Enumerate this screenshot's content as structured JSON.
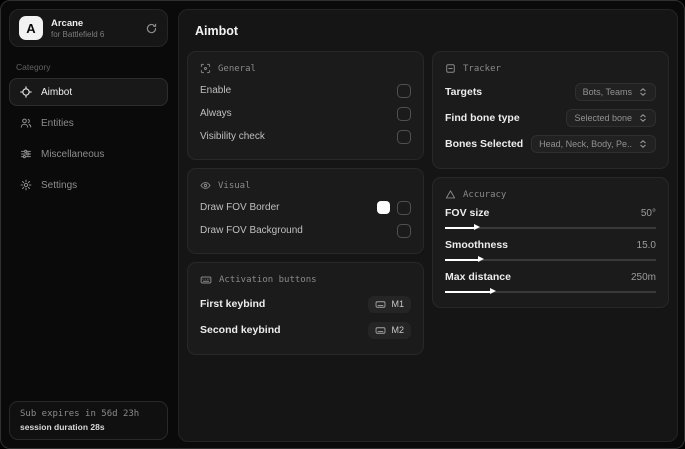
{
  "sidebar": {
    "logo_letter": "A",
    "app_name": "Arcane",
    "app_subtitle": "for Battlefield 6",
    "category_label": "Category",
    "items": [
      {
        "label": "Aimbot",
        "icon": "crosshair-icon",
        "active": true
      },
      {
        "label": "Entities",
        "icon": "users-icon",
        "active": false
      },
      {
        "label": "Miscellaneous",
        "icon": "sliders-icon",
        "active": false
      },
      {
        "label": "Settings",
        "icon": "gear-icon",
        "active": false
      }
    ],
    "footer": {
      "expiry": "Sub expires in 56d 23h",
      "session": "session duration 28s"
    }
  },
  "main": {
    "title": "Aimbot",
    "general": {
      "title": "General",
      "rows": [
        {
          "label": "Enable",
          "checked": false
        },
        {
          "label": "Always",
          "checked": false
        },
        {
          "label": "Visibility check",
          "checked": false
        }
      ]
    },
    "visual": {
      "title": "Visual",
      "rows": [
        {
          "label": "Draw FOV Border",
          "swatch_style": "background:#ffffff",
          "checked": false
        },
        {
          "label": "Draw FOV Background",
          "checked": false
        }
      ]
    },
    "activation": {
      "title": "Activation buttons",
      "rows": [
        {
          "label": "First keybind",
          "key": "M1"
        },
        {
          "label": "Second keybind",
          "key": "M2"
        }
      ]
    },
    "tracker": {
      "title": "Tracker",
      "rows": [
        {
          "label": "Targets",
          "value": "Bots, Teams"
        },
        {
          "label": "Find bone type",
          "value": "Selected bone"
        },
        {
          "label": "Bones Selected",
          "value": "Head, Neck, Body, Pe.."
        }
      ]
    },
    "accuracy": {
      "title": "Accuracy",
      "rows": [
        {
          "label": "FOV size",
          "value": "50°",
          "fill_style": "width:14%"
        },
        {
          "label": "Smoothness",
          "value": "15.0",
          "fill_style": "width:16%"
        },
        {
          "label": "Max distance",
          "value": "250m",
          "fill_style": "width:22%"
        }
      ]
    }
  },
  "colors": {
    "swatch": "#ffffff",
    "window_bg": "#0a0a0a",
    "panel_bg": "#151515",
    "card_bg": "#1b1b1b"
  }
}
